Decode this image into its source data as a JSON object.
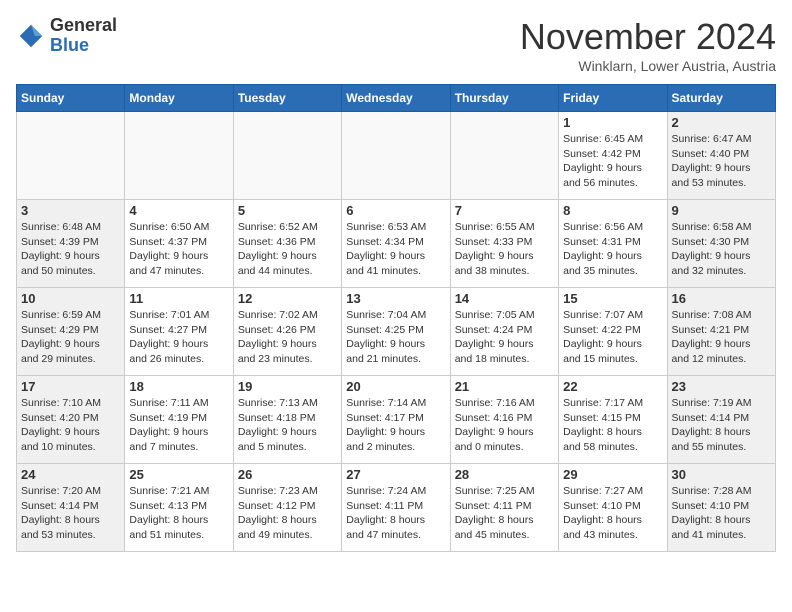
{
  "logo": {
    "general": "General",
    "blue": "Blue"
  },
  "header": {
    "month": "November 2024",
    "location": "Winklarn, Lower Austria, Austria"
  },
  "weekdays": [
    "Sunday",
    "Monday",
    "Tuesday",
    "Wednesday",
    "Thursday",
    "Friday",
    "Saturday"
  ],
  "weeks": [
    [
      {
        "day": "",
        "info": ""
      },
      {
        "day": "",
        "info": ""
      },
      {
        "day": "",
        "info": ""
      },
      {
        "day": "",
        "info": ""
      },
      {
        "day": "",
        "info": ""
      },
      {
        "day": "1",
        "info": "Sunrise: 6:45 AM\nSunset: 4:42 PM\nDaylight: 9 hours\nand 56 minutes."
      },
      {
        "day": "2",
        "info": "Sunrise: 6:47 AM\nSunset: 4:40 PM\nDaylight: 9 hours\nand 53 minutes."
      }
    ],
    [
      {
        "day": "3",
        "info": "Sunrise: 6:48 AM\nSunset: 4:39 PM\nDaylight: 9 hours\nand 50 minutes."
      },
      {
        "day": "4",
        "info": "Sunrise: 6:50 AM\nSunset: 4:37 PM\nDaylight: 9 hours\nand 47 minutes."
      },
      {
        "day": "5",
        "info": "Sunrise: 6:52 AM\nSunset: 4:36 PM\nDaylight: 9 hours\nand 44 minutes."
      },
      {
        "day": "6",
        "info": "Sunrise: 6:53 AM\nSunset: 4:34 PM\nDaylight: 9 hours\nand 41 minutes."
      },
      {
        "day": "7",
        "info": "Sunrise: 6:55 AM\nSunset: 4:33 PM\nDaylight: 9 hours\nand 38 minutes."
      },
      {
        "day": "8",
        "info": "Sunrise: 6:56 AM\nSunset: 4:31 PM\nDaylight: 9 hours\nand 35 minutes."
      },
      {
        "day": "9",
        "info": "Sunrise: 6:58 AM\nSunset: 4:30 PM\nDaylight: 9 hours\nand 32 minutes."
      }
    ],
    [
      {
        "day": "10",
        "info": "Sunrise: 6:59 AM\nSunset: 4:29 PM\nDaylight: 9 hours\nand 29 minutes."
      },
      {
        "day": "11",
        "info": "Sunrise: 7:01 AM\nSunset: 4:27 PM\nDaylight: 9 hours\nand 26 minutes."
      },
      {
        "day": "12",
        "info": "Sunrise: 7:02 AM\nSunset: 4:26 PM\nDaylight: 9 hours\nand 23 minutes."
      },
      {
        "day": "13",
        "info": "Sunrise: 7:04 AM\nSunset: 4:25 PM\nDaylight: 9 hours\nand 21 minutes."
      },
      {
        "day": "14",
        "info": "Sunrise: 7:05 AM\nSunset: 4:24 PM\nDaylight: 9 hours\nand 18 minutes."
      },
      {
        "day": "15",
        "info": "Sunrise: 7:07 AM\nSunset: 4:22 PM\nDaylight: 9 hours\nand 15 minutes."
      },
      {
        "day": "16",
        "info": "Sunrise: 7:08 AM\nSunset: 4:21 PM\nDaylight: 9 hours\nand 12 minutes."
      }
    ],
    [
      {
        "day": "17",
        "info": "Sunrise: 7:10 AM\nSunset: 4:20 PM\nDaylight: 9 hours\nand 10 minutes."
      },
      {
        "day": "18",
        "info": "Sunrise: 7:11 AM\nSunset: 4:19 PM\nDaylight: 9 hours\nand 7 minutes."
      },
      {
        "day": "19",
        "info": "Sunrise: 7:13 AM\nSunset: 4:18 PM\nDaylight: 9 hours\nand 5 minutes."
      },
      {
        "day": "20",
        "info": "Sunrise: 7:14 AM\nSunset: 4:17 PM\nDaylight: 9 hours\nand 2 minutes."
      },
      {
        "day": "21",
        "info": "Sunrise: 7:16 AM\nSunset: 4:16 PM\nDaylight: 9 hours\nand 0 minutes."
      },
      {
        "day": "22",
        "info": "Sunrise: 7:17 AM\nSunset: 4:15 PM\nDaylight: 8 hours\nand 58 minutes."
      },
      {
        "day": "23",
        "info": "Sunrise: 7:19 AM\nSunset: 4:14 PM\nDaylight: 8 hours\nand 55 minutes."
      }
    ],
    [
      {
        "day": "24",
        "info": "Sunrise: 7:20 AM\nSunset: 4:14 PM\nDaylight: 8 hours\nand 53 minutes."
      },
      {
        "day": "25",
        "info": "Sunrise: 7:21 AM\nSunset: 4:13 PM\nDaylight: 8 hours\nand 51 minutes."
      },
      {
        "day": "26",
        "info": "Sunrise: 7:23 AM\nSunset: 4:12 PM\nDaylight: 8 hours\nand 49 minutes."
      },
      {
        "day": "27",
        "info": "Sunrise: 7:24 AM\nSunset: 4:11 PM\nDaylight: 8 hours\nand 47 minutes."
      },
      {
        "day": "28",
        "info": "Sunrise: 7:25 AM\nSunset: 4:11 PM\nDaylight: 8 hours\nand 45 minutes."
      },
      {
        "day": "29",
        "info": "Sunrise: 7:27 AM\nSunset: 4:10 PM\nDaylight: 8 hours\nand 43 minutes."
      },
      {
        "day": "30",
        "info": "Sunrise: 7:28 AM\nSunset: 4:10 PM\nDaylight: 8 hours\nand 41 minutes."
      }
    ]
  ]
}
